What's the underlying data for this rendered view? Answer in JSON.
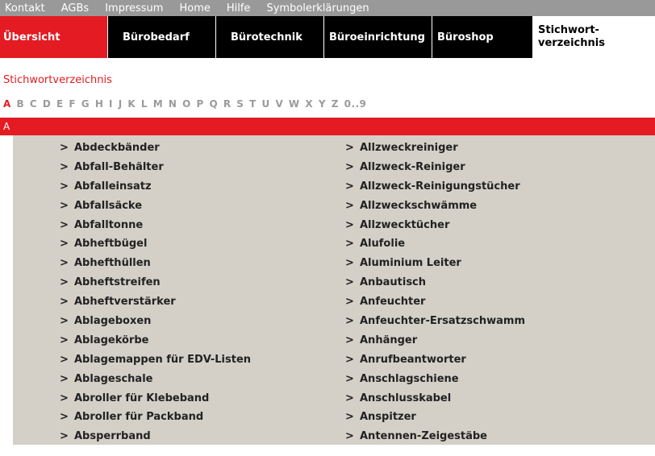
{
  "topnav": [
    "Kontakt",
    "AGBs",
    "Impressum",
    "Home",
    "Hilfe",
    "Symbolerklärungen"
  ],
  "tabs": {
    "uebersicht": "Übersicht",
    "buerobedarf": "Bürobedarf",
    "buerotechnik": "Bürotechnik",
    "bueroeinrichtung": "Büroeinrichtung",
    "bueroshop": "Büroshop",
    "stichwort_line1": "Stichwort-",
    "stichwort_line2": "verzeichnis"
  },
  "breadcrumb": "Stichwortverzeichnis",
  "alphabet": [
    "A",
    "B",
    "C",
    "D",
    "E",
    "F",
    "G",
    "H",
    "I",
    "J",
    "K",
    "L",
    "M",
    "N",
    "O",
    "P",
    "Q",
    "R",
    "S",
    "T",
    "U",
    "V",
    "W",
    "X",
    "Y",
    "Z",
    "0..9"
  ],
  "current_letter": "A",
  "chevron": ">",
  "left_items": [
    "Abdeckbänder",
    "Abfall-Behälter",
    "Abfalleinsatz",
    "Abfallsäcke",
    "Abfalltonne",
    "Abheftbügel",
    "Abhefthüllen",
    "Abheftstreifen",
    "Abheftverstärker",
    "Ablageboxen",
    "Ablagekörbe",
    "Ablagemappen für EDV-Listen",
    "Ablageschale",
    "Abroller für Klebeband",
    "Abroller für Packband",
    "Absperrband"
  ],
  "right_items": [
    "Allzweckreiniger",
    "Allzweck-Reiniger",
    "Allzweck-Reinigungstücher",
    "Allzweckschwämme",
    "Allzwecktücher",
    "Alufolie",
    "Aluminium Leiter",
    "Anbautisch",
    "Anfeuchter",
    "Anfeuchter-Ersatzschwamm",
    "Anhänger",
    "Anrufbeantworter",
    "Anschlagschiene",
    "Anschlusskabel",
    "Anspitzer",
    "Antennen-Zeigestäbe"
  ],
  "colors": {
    "accent": "#e41b23",
    "topnav": "#999999",
    "list_bg": "#d4d0c8"
  }
}
